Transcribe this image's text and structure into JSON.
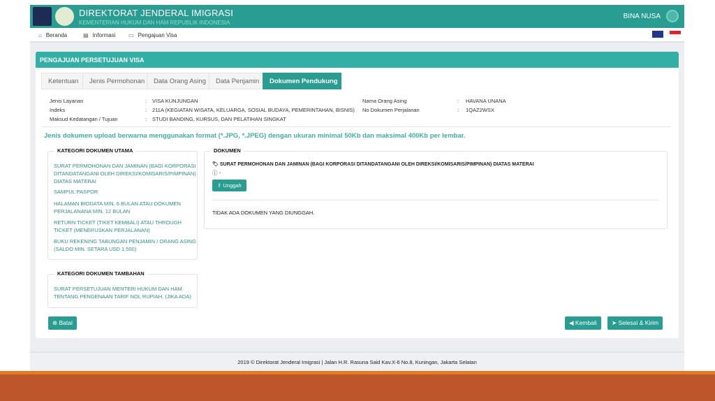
{
  "header": {
    "title": "DIREKTORAT JENDERAL IMIGRASI",
    "subtitle": "KEMENTERIAN HUKUM DAN HAM REPUBLIK INDONESIA",
    "user": "BINA NUSA"
  },
  "nav": [
    {
      "label": "Beranda",
      "icon": "home-icon"
    },
    {
      "label": "Informasi",
      "icon": "book-icon"
    },
    {
      "label": "Pengajuan Visa",
      "icon": "id-card-icon"
    }
  ],
  "panel": {
    "title": "PENGAJUAN PERSETUJUAN VISA",
    "tabs": [
      "Ketentuan",
      "Jenis Permohonan",
      "Data Orang Asing",
      "Data Penjamin",
      "Dokumen Pendukung"
    ],
    "active_tab": "Dokumen Pendukung",
    "info_left": [
      {
        "label": "Jenis Layanan",
        "value": "VISA KUNJUNGAN"
      },
      {
        "label": "Indeks",
        "value": "211A   (KEGIATAN WISATA, KELUARGA, SOSIAL BUDAYA, PEMERINTAHAN, BISNIS)"
      },
      {
        "label": "Maksud Kedatangan / Tujuan",
        "value": "STUDI BANDING, KURSUS, DAN PELATIHAN SINGKAT"
      }
    ],
    "info_right": [
      {
        "label": "Nama Orang Asing",
        "value": "HAVANA UNANA"
      },
      {
        "label": "No Dokumen Perjalanan",
        "value": "1QAZ2WSX"
      }
    ],
    "notice": "Jenis dokumen upload berwarna menggunakan format (*.JPG, *.JPEG) dengan ukuran minimal 50Kb dan maksimal 400Kb per lembar.",
    "kategori_utama": {
      "title": "KATEGORI DOKUMEN UTAMA",
      "items": [
        "SURAT PERMOHONAN DAN JAMINAN (BAGI KORPORASI DITANDATANGANI OLEH DIREKSI/KOMISARIS/PIMPINAN) DIATAS MATERAI",
        "SAMPUL PASPOR",
        "HALAMAN BIODATA MIN. 6 BULAN ATAU DOKUMEN PERJALANANA MIN. 12 BULAN",
        "RETURN TICKET (TIKET KEMBALI) ATAU THROUGH TICKET (MENERUSKAN PERJALANAN)",
        "BUKU REKENING TABUNGAN PENJAMIN / ORANG ASING (SALDO MIN. SETARA USD 1.500)"
      ]
    },
    "kategori_tambahan": {
      "title": "KATEGORI DOKUMEN TAMBAHAN",
      "items": [
        "SURAT PERSETUJUAN MENTERI HUKUM DAN HAM TENTANG PENGENAAN TARIF NOL RUPIAH, (JIKA ADA)"
      ]
    },
    "dokumen": {
      "title": "DOKUMEN",
      "doc_name": "SURAT PERMOHONAN DAN JAMINAN (BAGI KORPORASI DITANDATANGANI OLEH DIREKSI/KOMISARIS/PIMPINAN) DIATAS MATERAI",
      "info": "-",
      "upload_label": "Unggah",
      "empty": "TIDAK ADA DOKUMEN YANG DIUNGGAH."
    },
    "buttons": {
      "cancel": "Batal",
      "back": "Kembali",
      "submit": "Selesai & Kirim"
    }
  },
  "footer": "2019 © Direktorat Jenderal Imigrasi | Jalan H.R. Rasuna Said Kav.X-6 No.8, Kuningan, Jakarta Selatan",
  "colors": {
    "primary": "#2a9d92",
    "accent_bar": "#bd572b"
  }
}
